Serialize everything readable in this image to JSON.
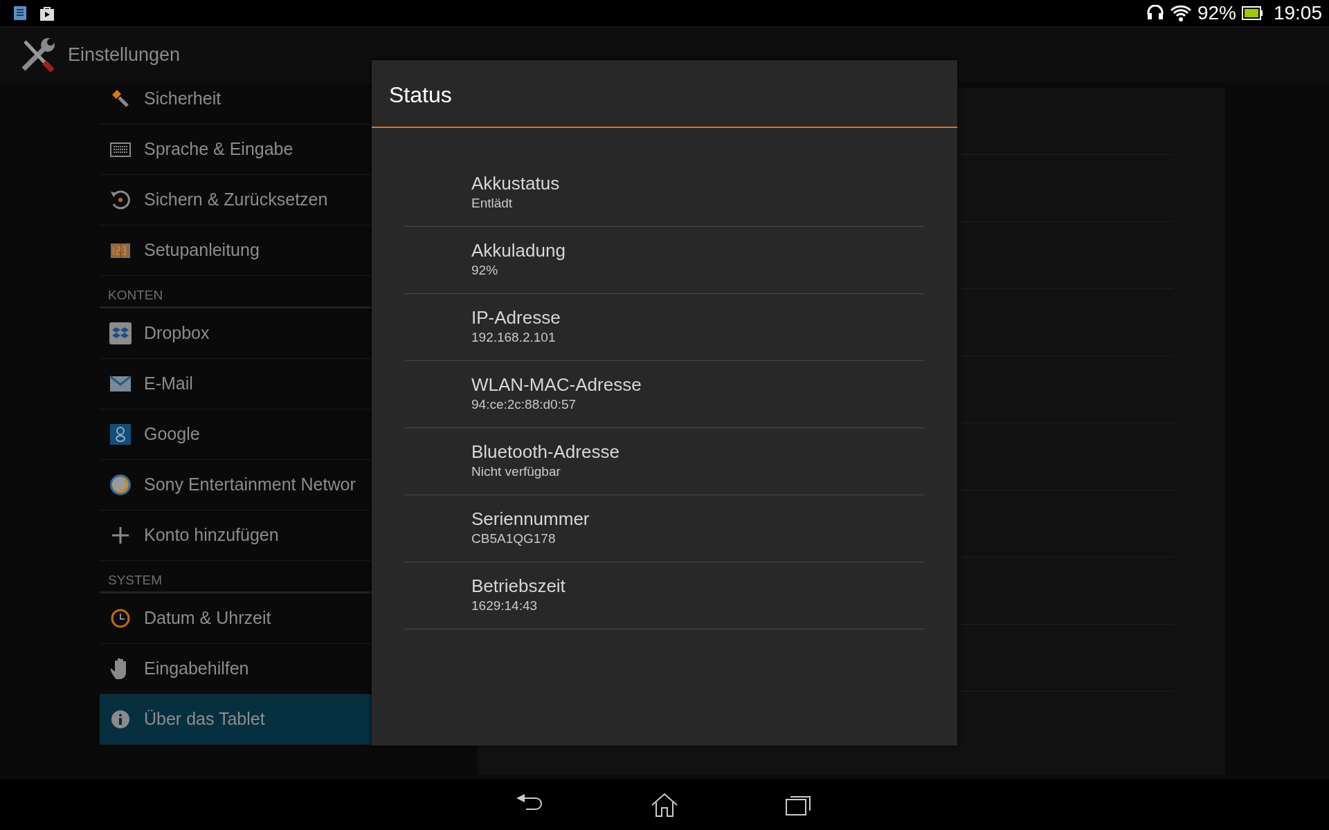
{
  "status_bar": {
    "battery_text": "92%",
    "time": "19:05"
  },
  "app_bar": {
    "title": "Einstellungen"
  },
  "sidebar": {
    "items": [
      {
        "kind": "item",
        "label": "Sicherheit",
        "selected": false
      },
      {
        "kind": "item",
        "label": "Sprache & Eingabe",
        "selected": false
      },
      {
        "kind": "item",
        "label": "Sichern & Zurücksetzen",
        "selected": false
      },
      {
        "kind": "item",
        "label": "Setupanleitung",
        "selected": false
      },
      {
        "kind": "header",
        "label": "KONTEN"
      },
      {
        "kind": "item",
        "label": "Dropbox",
        "selected": false
      },
      {
        "kind": "item",
        "label": "E-Mail",
        "selected": false
      },
      {
        "kind": "item",
        "label": "Google",
        "selected": false
      },
      {
        "kind": "item",
        "label": "Sony Entertainment Networ",
        "selected": false
      },
      {
        "kind": "item",
        "label": "Konto hinzufügen",
        "selected": false
      },
      {
        "kind": "header",
        "label": "SYSTEM"
      },
      {
        "kind": "item",
        "label": "Datum & Uhrzeit",
        "selected": false
      },
      {
        "kind": "item",
        "label": "Eingabehilfen",
        "selected": false
      },
      {
        "kind": "item",
        "label": "Über das Tablet",
        "selected": true
      }
    ]
  },
  "dialog": {
    "title": "Status",
    "rows": [
      {
        "label": "Akkustatus",
        "value": "Entlädt"
      },
      {
        "label": "Akkuladung",
        "value": "92%"
      },
      {
        "label": "IP-Adresse",
        "value": "192.168.2.101"
      },
      {
        "label": "WLAN-MAC-Adresse",
        "value": "94:ce:2c:88:d0:57"
      },
      {
        "label": "Bluetooth-Adresse",
        "value": "Nicht verfügbar"
      },
      {
        "label": "Seriennummer",
        "value": "CB5A1QG178"
      },
      {
        "label": "Betriebszeit",
        "value": "1629:14:43"
      }
    ]
  }
}
